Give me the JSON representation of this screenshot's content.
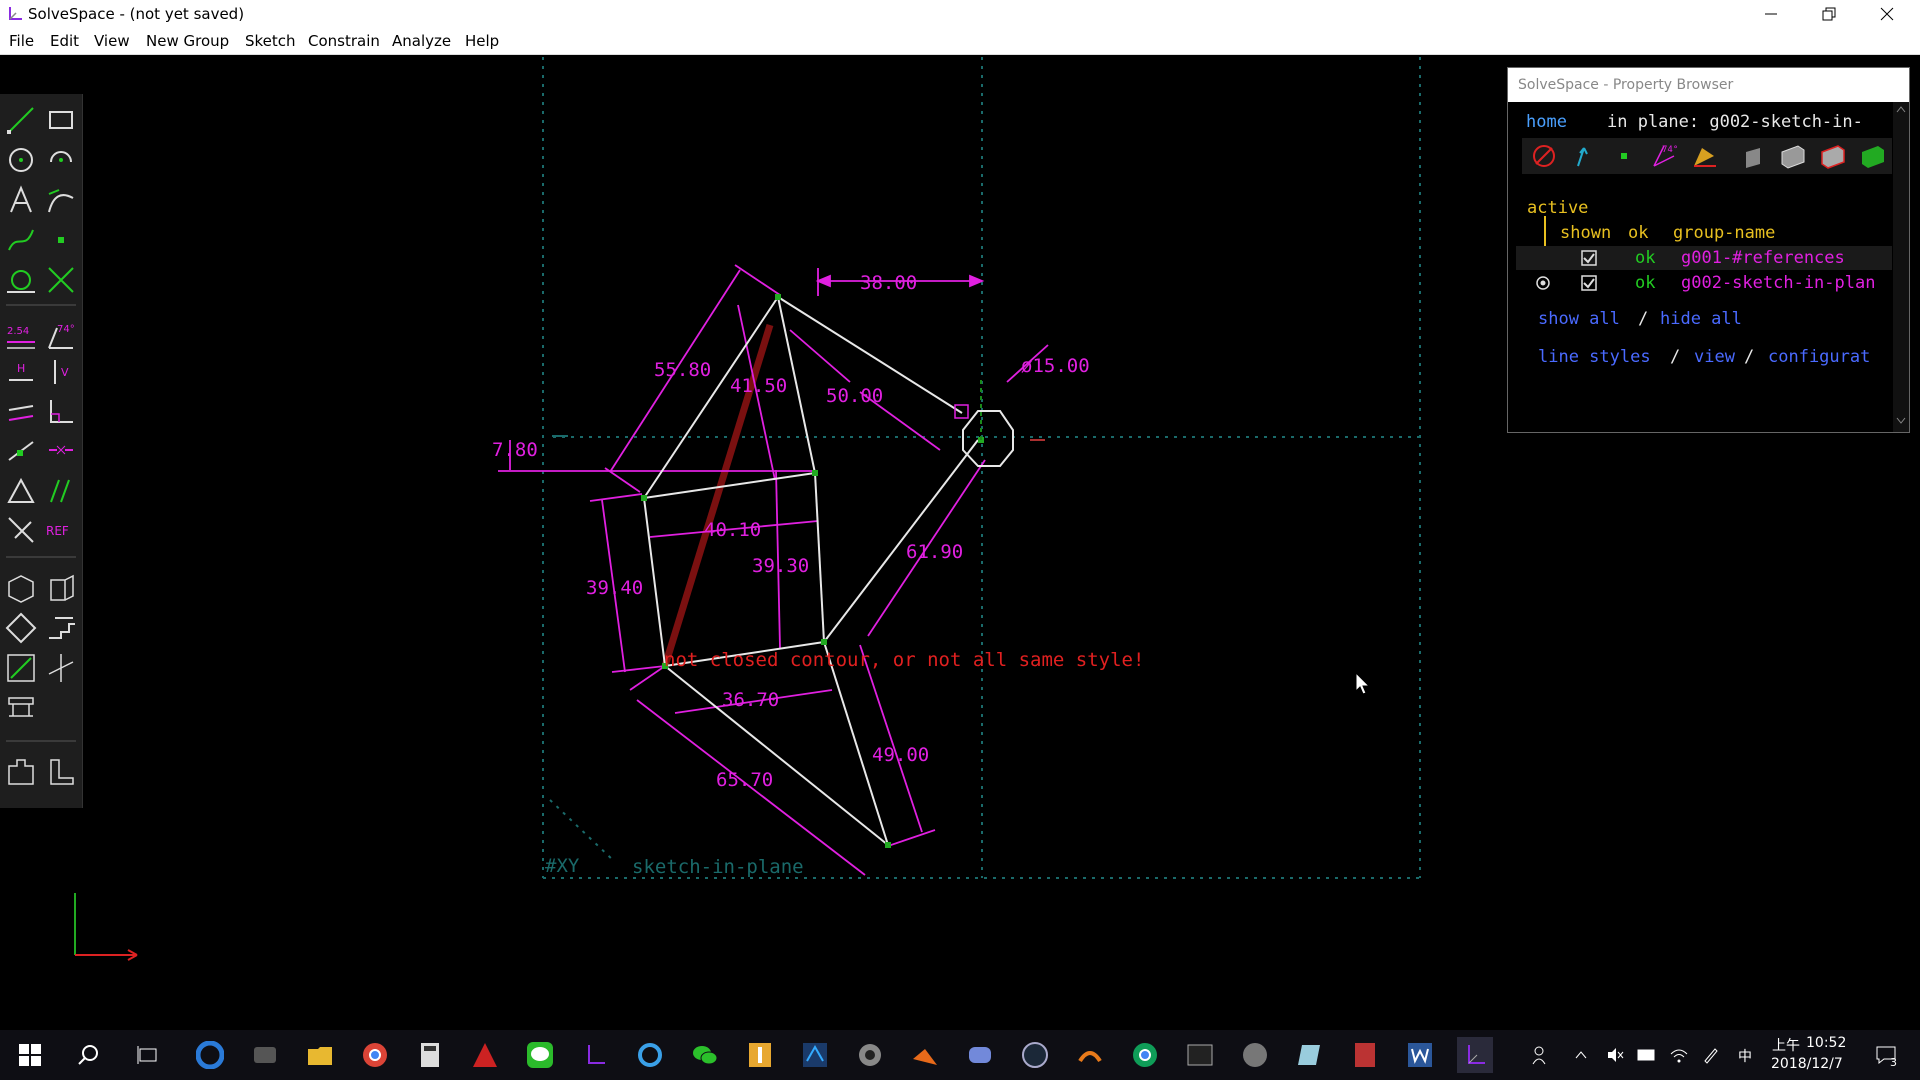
{
  "window": {
    "title": "SolveSpace - (not yet saved)"
  },
  "menu": [
    "File",
    "Edit",
    "View",
    "New Group",
    "Sketch",
    "Constrain",
    "Analyze",
    "Help"
  ],
  "toolbar": {
    "ref_label": "REF",
    "dim_label": "2.54",
    "angle_label": "74°",
    "h_label": "H",
    "v_label": "V"
  },
  "sketch": {
    "dimensions": [
      "38.00",
      "55.80",
      "41.50",
      "50.00",
      "ø15.00",
      "7.80",
      "40.10",
      "39.30",
      "61.90",
      "39.40",
      "36.70",
      "65.70",
      "49.00"
    ],
    "error_text": "not closed contour, or not all same style!",
    "workplane_label": "#XY",
    "group_label": "sketch-in-plane"
  },
  "property_browser": {
    "title": "SolveSpace - Property Browser",
    "home": "home",
    "in_plane": "in plane: g002-sketch-in-",
    "active": "active",
    "col_shown": "shown",
    "col_ok": "ok",
    "col_group": "group-name",
    "groups": [
      {
        "ok": "ok",
        "name": "g001-#references"
      },
      {
        "ok": "ok",
        "name": "g002-sketch-in-plan"
      }
    ],
    "show_all": "show all",
    "slash": "/",
    "hide_all": "hide all",
    "line_styles": "line styles",
    "view": "view",
    "configuration": "configurat",
    "icon_angle": "74°"
  },
  "taskbar": {
    "time": "10:52",
    "ampm": "上午",
    "date": "2018/12/7",
    "ime": "中",
    "notifications": "3"
  },
  "colors": {
    "dimension": "#e020e0",
    "line": "#e8e8e8",
    "error": "#e02020",
    "point": "#22aa22",
    "grid": "#1a6a6a"
  }
}
